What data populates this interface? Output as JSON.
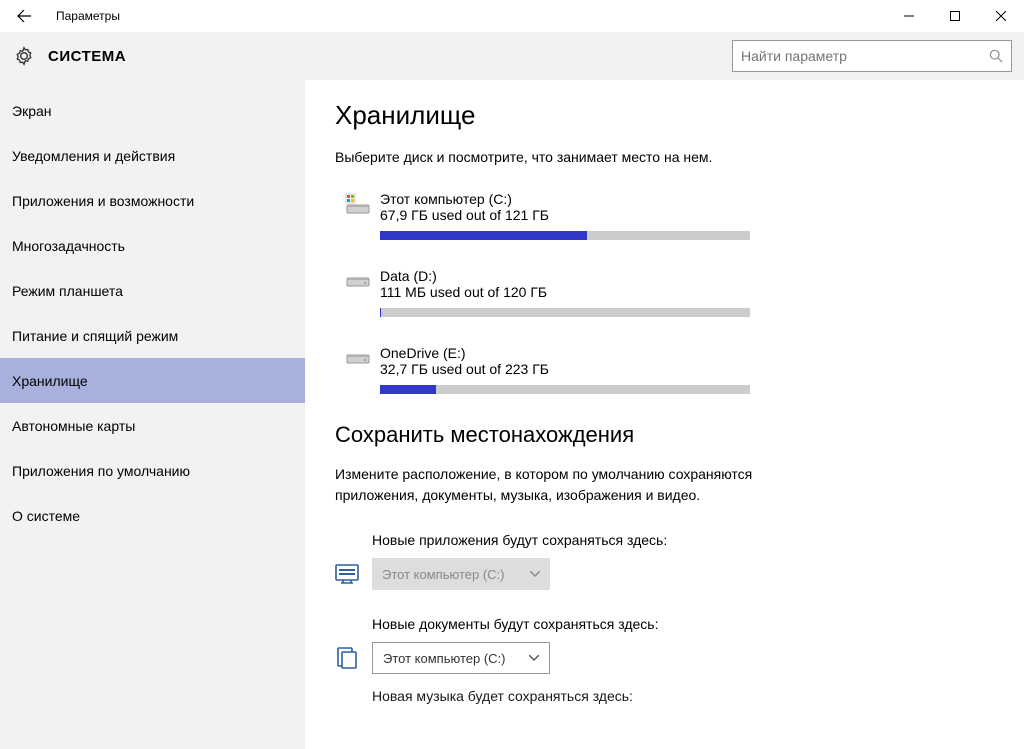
{
  "window": {
    "title": "Параметры"
  },
  "header": {
    "section": "СИСТЕМА",
    "search_placeholder": "Найти параметр"
  },
  "sidebar": {
    "items": [
      {
        "label": "Экран"
      },
      {
        "label": "Уведомления и действия"
      },
      {
        "label": "Приложения и возможности"
      },
      {
        "label": "Многозадачность"
      },
      {
        "label": "Режим планшета"
      },
      {
        "label": "Питание и спящий режим"
      },
      {
        "label": "Хранилище",
        "selected": true
      },
      {
        "label": "Автономные карты"
      },
      {
        "label": "Приложения по умолчанию"
      },
      {
        "label": "О системе"
      }
    ]
  },
  "main": {
    "storage": {
      "title": "Хранилище",
      "description": "Выберите диск и посмотрите, что занимает место на нем.",
      "drives": [
        {
          "name": "Этот компьютер (C:)",
          "usage_text": "67,9 ГБ used out of 121 ГБ",
          "fill_percent": 56,
          "kind": "system"
        },
        {
          "name": "Data (D:)",
          "usage_text": "111 МБ used out of 120 ГБ",
          "fill_percent": 0.2,
          "kind": "hdd"
        },
        {
          "name": "OneDrive (E:)",
          "usage_text": "32,7 ГБ used out of 223 ГБ",
          "fill_percent": 15,
          "kind": "hdd"
        }
      ]
    },
    "save_locations": {
      "title": "Сохранить местонахождения",
      "description": "Измените расположение, в котором по умолчанию сохраняются приложения, документы, музыка, изображения и видео.",
      "rows": [
        {
          "label": "Новые приложения будут сохраняться здесь:",
          "value": "Этот компьютер (C:)",
          "disabled": true,
          "icon": "apps"
        },
        {
          "label": "Новые документы будут сохраняться здесь:",
          "value": "Этот компьютер (C:)",
          "disabled": false,
          "icon": "documents"
        }
      ],
      "cutoff_label": "Новая музыка будет сохраняться здесь:"
    }
  }
}
